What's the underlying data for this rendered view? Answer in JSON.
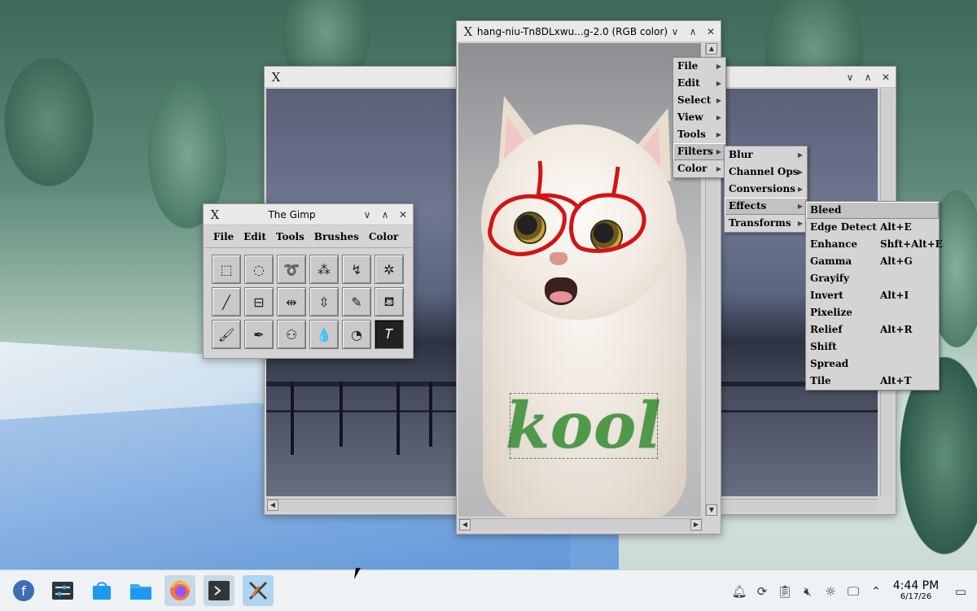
{
  "back_window": {
    "controls": [
      "∨",
      "∧",
      "✕"
    ]
  },
  "cat_window": {
    "title": "hang-niu-Tn8DLxwu...g-2.0 (RGB color)",
    "controls": [
      "∨",
      "∧",
      "✕"
    ],
    "overlay_text": "kool"
  },
  "gimp_window": {
    "title": "The Gimp",
    "controls": [
      "∨",
      "∧",
      "✕"
    ],
    "menu": [
      "File",
      "Edit",
      "Tools",
      "Brushes",
      "Color"
    ],
    "tool_icons": [
      "rect-select-icon",
      "ellipse-select-icon",
      "free-select-icon",
      "fuzzy-select-icon",
      "bezier-select-icon",
      "intelligent-scissors-icon",
      "move-icon",
      "magnify-icon",
      "crop-icon",
      "transform-icon",
      "flip-icon",
      "color-picker-icon",
      "bucket-fill-icon",
      "blend-icon",
      "pencil-icon",
      "paintbrush-icon",
      "clone-icon",
      "text-icon"
    ]
  },
  "image_menu": {
    "items": [
      {
        "label": "File"
      },
      {
        "label": "Edit"
      },
      {
        "label": "Select"
      },
      {
        "label": "View"
      },
      {
        "label": "Tools"
      },
      {
        "label": "Filters"
      },
      {
        "label": "Color"
      }
    ]
  },
  "filters_menu": {
    "items": [
      {
        "label": "Blur"
      },
      {
        "label": "Channel Ops"
      },
      {
        "label": "Conversions"
      },
      {
        "label": "Effects"
      },
      {
        "label": "Transforms"
      }
    ]
  },
  "effects_menu": {
    "items": [
      {
        "label": "Bleed",
        "accel": ""
      },
      {
        "label": "Edge Detect",
        "accel": "Alt+E"
      },
      {
        "label": "Enhance",
        "accel": "Shft+Alt+E"
      },
      {
        "label": "Gamma",
        "accel": "Alt+G"
      },
      {
        "label": "Grayify",
        "accel": ""
      },
      {
        "label": "Invert",
        "accel": "Alt+I"
      },
      {
        "label": "Pixelize",
        "accel": ""
      },
      {
        "label": "Relief",
        "accel": "Alt+R"
      },
      {
        "label": "Shift",
        "accel": ""
      },
      {
        "label": "Spread",
        "accel": ""
      },
      {
        "label": "Tile",
        "accel": "Alt+T"
      }
    ]
  },
  "taskbar": {
    "apps": [
      "fedora-launcher-icon",
      "system-settings-icon",
      "software-center-icon",
      "file-manager-icon",
      "firefox-icon",
      "terminal-icon",
      "x11-app-icon"
    ],
    "clock": {
      "time": "4:44 PM",
      "date": "6/17/26"
    }
  }
}
